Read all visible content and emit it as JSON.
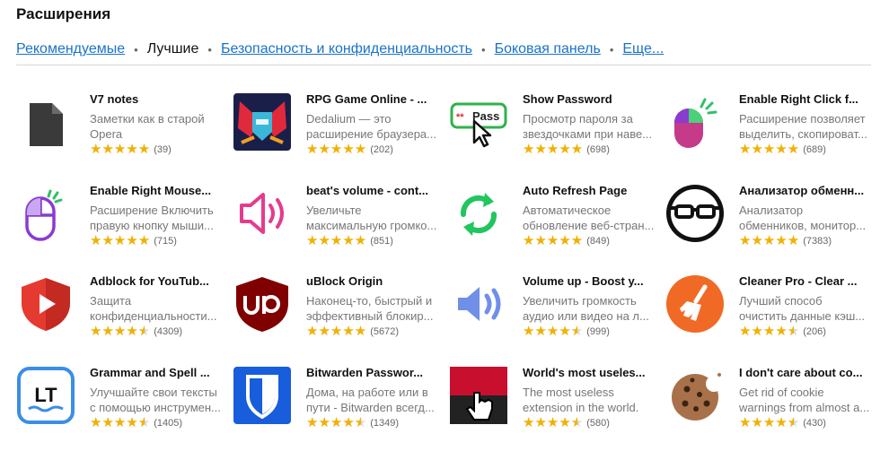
{
  "page_title": "Расширения",
  "tabs": [
    {
      "label": "Рекомендуемые",
      "active": false
    },
    {
      "label": "Лучшие",
      "active": true
    },
    {
      "label": "Безопасность и конфиденциальность",
      "active": false
    },
    {
      "label": "Боковая панель",
      "active": false
    },
    {
      "label": "Еще...",
      "active": false
    }
  ],
  "stars_glyph": "★★★★★",
  "extensions": [
    {
      "name": "V7 notes",
      "desc": [
        "Заметки как в старой",
        "Opera"
      ],
      "rating": 5,
      "count": "(39)",
      "icon": "document-icon"
    },
    {
      "name": "RPG Game Online - ...",
      "desc": [
        "Dedalium — это",
        "расширение браузера..."
      ],
      "rating": 5,
      "count": "(202)",
      "icon": "game-robot-icon"
    },
    {
      "name": "Show Password",
      "desc": [
        "Просмотр пароля за",
        "звездочками при наве..."
      ],
      "rating": 5,
      "count": "(698)",
      "icon": "password-pass-icon"
    },
    {
      "name": "Enable Right Click f...",
      "desc": [
        "Расширение позволяет",
        "выделить, скопироват..."
      ],
      "rating": 5,
      "count": "(689)",
      "icon": "mouse-click-icon"
    },
    {
      "name": "Enable Right Mouse...",
      "desc": [
        "Расширение Включить",
        "правую кнопку мыши..."
      ],
      "rating": 5,
      "count": "(715)",
      "icon": "mouse-outline-icon"
    },
    {
      "name": "beat's volume - cont...",
      "desc": [
        "Увеличьте",
        "максимальную громко..."
      ],
      "rating": 5,
      "count": "(851)",
      "icon": "speaker-pink-icon"
    },
    {
      "name": "Auto Refresh Page",
      "desc": [
        "Автоматическое",
        "обновление веб-стран..."
      ],
      "rating": 5,
      "count": "(849)",
      "icon": "refresh-icon"
    },
    {
      "name": "Анализатор обменн...",
      "desc": [
        "Анализатор",
        "обменников, монитор..."
      ],
      "rating": 5,
      "count": "(7383)",
      "icon": "glasses-face-icon"
    },
    {
      "name": "Adblock for YouTub...",
      "desc": [
        "Защита",
        "конфиденциальности..."
      ],
      "rating": 4.5,
      "count": "(4309)",
      "icon": "shield-play-icon"
    },
    {
      "name": "uBlock Origin",
      "desc": [
        "Наконец-то, быстрый и",
        "эффективный блокир..."
      ],
      "rating": 5,
      "count": "(5672)",
      "icon": "ublock-shield-icon"
    },
    {
      "name": "Volume up - Boost y...",
      "desc": [
        "Увеличить громкость",
        "аудио или видео на л..."
      ],
      "rating": 4.5,
      "count": "(999)",
      "icon": "speaker-blue-icon"
    },
    {
      "name": "Cleaner Pro - Clear ...",
      "desc": [
        "Лучший способ",
        "очистить данные кэш..."
      ],
      "rating": 4.5,
      "count": "(206)",
      "icon": "broom-icon"
    },
    {
      "name": "Grammar and Spell ...",
      "desc": [
        "Улучшайте свои тексты",
        "с помощью инструмен..."
      ],
      "rating": 4.5,
      "count": "(1405)",
      "icon": "languagetool-icon"
    },
    {
      "name": "Bitwarden Passwor...",
      "desc": [
        "Дома, на работе или в",
        "пути - Bitwarden всегд..."
      ],
      "rating": 4.5,
      "count": "(1349)",
      "icon": "bitwarden-shield-icon"
    },
    {
      "name": "World's most useles...",
      "desc": [
        "The most useless",
        "extension in the world."
      ],
      "rating": 4.5,
      "count": "(580)",
      "icon": "pointer-hand-icon"
    },
    {
      "name": "I don't care about co...",
      "desc": [
        "Get rid of cookie",
        "warnings from almost a..."
      ],
      "rating": 4.5,
      "count": "(430)",
      "icon": "cookie-icon"
    }
  ]
}
